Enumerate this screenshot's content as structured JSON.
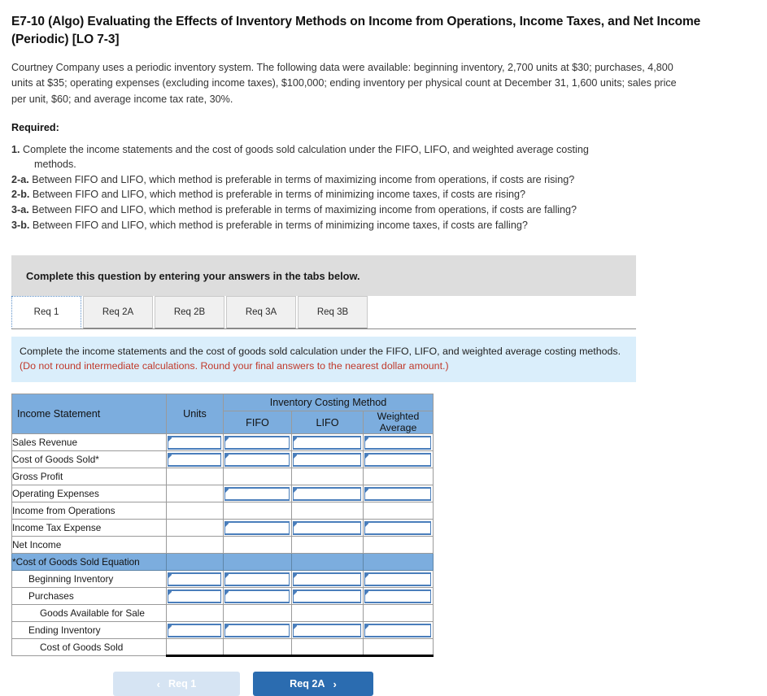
{
  "title": "E7-10 (Algo) Evaluating the Effects of Inventory Methods on Income from Operations, Income Taxes, and Net Income (Periodic) [LO 7-3]",
  "problem": "Courtney Company uses a periodic inventory system. The following data were available: beginning inventory, 2,700 units at $30; purchases, 4,800 units at $35; operating expenses (excluding income taxes), $100,000; ending inventory per physical count at December 31, 1,600 units; sales price per unit, $60; and average income tax rate, 30%.",
  "required": {
    "heading": "Required:",
    "items": [
      {
        "lead": "1.",
        "text": "Complete the income statements and the cost of goods sold calculation under the FIFO, LIFO, and weighted average costing",
        "cont": "methods."
      },
      {
        "lead": "2-a.",
        "text": "Between FIFO and LIFO, which method is preferable in terms of maximizing income from operations, if costs are rising?",
        "cont": ""
      },
      {
        "lead": "2-b.",
        "text": "Between FIFO and LIFO, which method is preferable in terms of minimizing income taxes, if costs are rising?",
        "cont": ""
      },
      {
        "lead": "3-a.",
        "text": "Between FIFO and LIFO, which method is preferable in terms of maximizing income from operations, if costs are falling?",
        "cont": ""
      },
      {
        "lead": "3-b.",
        "text": "Between FIFO and LIFO, which method is preferable in terms of minimizing income taxes, if costs are falling?",
        "cont": ""
      }
    ]
  },
  "banner": "Complete this question by entering your answers in the tabs below.",
  "tabs": [
    {
      "label": "Req 1",
      "active": true
    },
    {
      "label": "Req 2A",
      "active": false
    },
    {
      "label": "Req 2B",
      "active": false
    },
    {
      "label": "Req 3A",
      "active": false
    },
    {
      "label": "Req 3B",
      "active": false
    }
  ],
  "instruction": {
    "main": "Complete the income statements and the cost of goods sold calculation under the FIFO, LIFO, and weighted average costing methods.",
    "warning": "(Do not round intermediate calculations. Round your final answers to the nearest dollar amount.)"
  },
  "table": {
    "header": {
      "col_label": "Income Statement",
      "col_units": "Units",
      "group": "Inventory Costing Method",
      "sub_fifo": "FIFO",
      "sub_lifo": "LIFO",
      "sub_wavg_line1": "Weighted",
      "sub_wavg_line2": "Average"
    },
    "rows": [
      {
        "label": "Sales Revenue",
        "indent": 0,
        "units": "input",
        "fifo": "input",
        "lifo": "input",
        "wavg": "input",
        "style": ""
      },
      {
        "label": "Cost of Goods Sold*",
        "indent": 0,
        "units": "input",
        "fifo": "input",
        "lifo": "input",
        "wavg": "input",
        "style": ""
      },
      {
        "label": "Gross Profit",
        "indent": 0,
        "units": "blank",
        "fifo": "blank",
        "lifo": "blank",
        "wavg": "blank",
        "style": "topblack"
      },
      {
        "label": "Operating Expenses",
        "indent": 0,
        "units": "blank",
        "fifo": "input",
        "lifo": "input",
        "wavg": "input",
        "style": ""
      },
      {
        "label": "Income from Operations",
        "indent": 0,
        "units": "blank",
        "fifo": "blank",
        "lifo": "blank",
        "wavg": "blank",
        "style": "topblack"
      },
      {
        "label": "Income Tax Expense",
        "indent": 0,
        "units": "blank",
        "fifo": "input",
        "lifo": "input",
        "wavg": "input",
        "style": ""
      },
      {
        "label": "Net Income",
        "indent": 0,
        "units": "blank",
        "fifo": "blank",
        "lifo": "blank",
        "wavg": "blank",
        "style": "topblack"
      },
      {
        "label": "*Cost of Goods Sold Equation",
        "indent": 0,
        "units": "eq",
        "fifo": "eq",
        "lifo": "eq",
        "wavg": "eq",
        "style": "eqrow"
      },
      {
        "label": "Beginning Inventory",
        "indent": 1,
        "units": "input",
        "fifo": "input",
        "lifo": "input",
        "wavg": "input",
        "style": ""
      },
      {
        "label": "Purchases",
        "indent": 1,
        "units": "input",
        "fifo": "input",
        "lifo": "input",
        "wavg": "input",
        "style": ""
      },
      {
        "label": "Goods Available for Sale",
        "indent": 2,
        "units": "blank",
        "fifo": "blank",
        "lifo": "blank",
        "wavg": "blank",
        "style": "topblack"
      },
      {
        "label": "Ending Inventory",
        "indent": 1,
        "units": "input",
        "fifo": "input",
        "lifo": "input",
        "wavg": "input",
        "style": ""
      },
      {
        "label": "Cost of Goods Sold",
        "indent": 2,
        "units": "blank",
        "fifo": "blank",
        "lifo": "blank",
        "wavg": "blank",
        "style": "topblack lastrow"
      }
    ]
  },
  "nav": {
    "prev_label": "Req 1",
    "prev_chevron": "‹",
    "next_label": "Req 2A",
    "next_chevron": "›"
  },
  "colors": {
    "header_blue": "#7cadde",
    "banner_gray": "#dddddd",
    "info_blue": "#daeefb",
    "warning_red": "#c0392b",
    "primary_button": "#2b6cb0",
    "disabled_button": "#d6e4f3",
    "input_border": "#4a7ebb"
  }
}
